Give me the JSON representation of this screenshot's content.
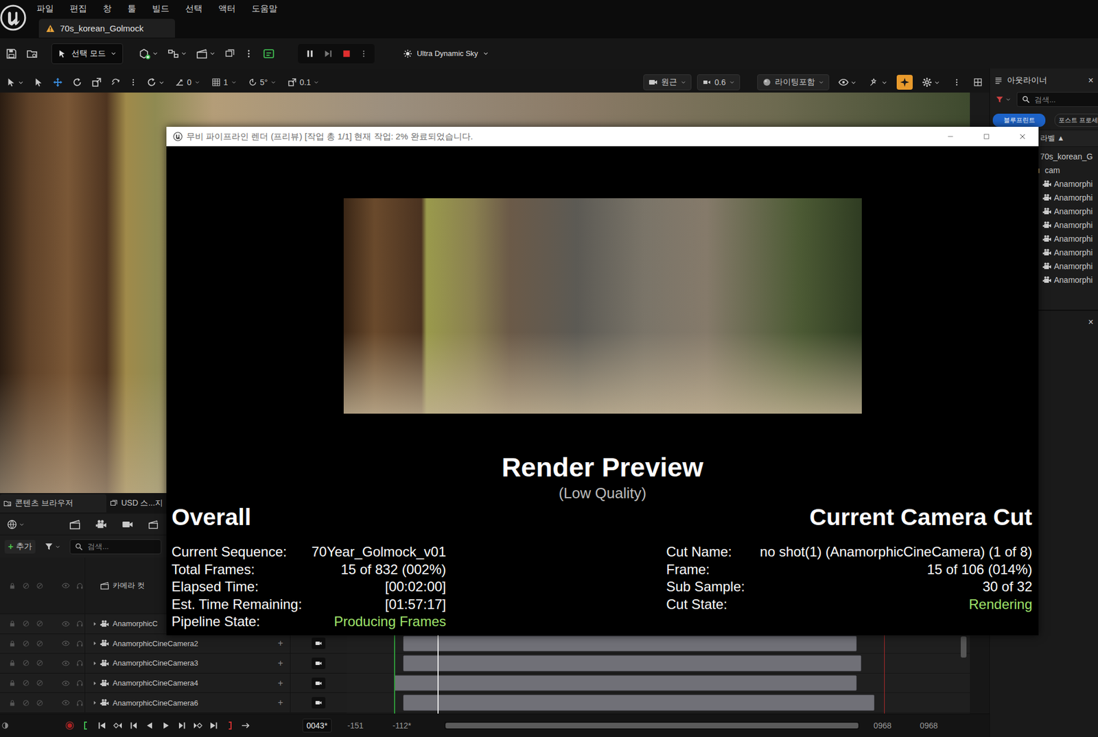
{
  "menu": [
    "파일",
    "편집",
    "창",
    "툴",
    "빌드",
    "선택",
    "액터",
    "도움말"
  ],
  "level_tab": {
    "label": "70s_korean_Golmock"
  },
  "toolbar": {
    "mode": "선택 모드",
    "playing": true,
    "sky": "Ultra Dynamic Sky"
  },
  "viewport_toolbar": {
    "transform_tools": [
      {
        "kind": "select",
        "selected": false
      },
      {
        "kind": "move",
        "selected": true
      },
      {
        "kind": "rotate",
        "selected": false
      },
      {
        "kind": "scale",
        "selected": false
      }
    ],
    "snaps": [
      {
        "kind": "surface",
        "value": "0"
      },
      {
        "kind": "grid",
        "value": "1"
      },
      {
        "kind": "rotate",
        "value": "5°"
      },
      {
        "kind": "scale",
        "value": "0.1"
      }
    ],
    "view": "원근",
    "camera_speed": "0.6",
    "view_mode": "라이팅포함",
    "highlight_toggle_on": true
  },
  "outliner": {
    "title": "아웃라이너",
    "close": "×",
    "search": "검색...",
    "tabs": [
      {
        "label": "블루프린트",
        "selected": true
      },
      {
        "label": "포스트 프로세",
        "selected": false
      }
    ],
    "sort_column": "라벨 ▲",
    "items": [
      {
        "label": "70s_korean_G",
        "kind": "level"
      },
      {
        "label": "cam",
        "kind": "folder"
      },
      {
        "label": "Anamorphi",
        "kind": "camera"
      },
      {
        "label": "Anamorphi",
        "kind": "camera"
      },
      {
        "label": "Anamorphi",
        "kind": "camera"
      },
      {
        "label": "Anamorphi",
        "kind": "camera"
      },
      {
        "label": "Anamorphi",
        "kind": "camera"
      },
      {
        "label": "Anamorphi",
        "kind": "camera"
      },
      {
        "label": "Anamorphi",
        "kind": "camera"
      },
      {
        "label": "Anamorphi",
        "kind": "camera"
      }
    ]
  },
  "details_panel": {
    "close": "×"
  },
  "bottom_tabs": [
    {
      "label": "콘텐츠 브라우저",
      "selected": true
    },
    {
      "label": "USD 스...지",
      "selected": false
    }
  ],
  "sequencer": {
    "add_icon": "+",
    "add": "추가",
    "search": "검색...",
    "camera_cut": "카메라 컷",
    "track_add": "+",
    "tracks": [
      {
        "label": "AnamorphicC"
      },
      {
        "label": "AnamorphicCineCamera2"
      },
      {
        "label": "AnamorphicCineCamera3"
      },
      {
        "label": "AnamorphicCineCamera4"
      },
      {
        "label": "AnamorphicCineCamera6"
      }
    ]
  },
  "timeline": {
    "current": "0043*",
    "view_start": "-151",
    "play_start": "-112*",
    "play_end": "0968",
    "view_end": "0968"
  },
  "render_window": {
    "title": "무비 파이프라인 렌더 (프리뷰) [작업 총 1/1] 현재 작업: 2% 완료되었습니다.",
    "heading": "Render Preview",
    "subheading": "(Low Quality)",
    "overall": {
      "title": "Overall",
      "rows": [
        {
          "label": "Current Sequence:",
          "value": "70Year_Golmock_v01",
          "kind": "value"
        },
        {
          "label": "Total Frames:",
          "value": "15 of 832 (002%)",
          "kind": "value"
        },
        {
          "label": "Elapsed Time:",
          "value": "[00:02:00]",
          "kind": "value"
        },
        {
          "label": "Est. Time Remaining:",
          "value": "[01:57:17]",
          "kind": "value"
        },
        {
          "label": "Pipeline State:",
          "value": "Producing Frames",
          "kind": "status"
        }
      ]
    },
    "camera_cut": {
      "title": "Current Camera Cut",
      "rows": [
        {
          "label": "Cut Name:",
          "value": "no shot(1) (AnamorphicCineCamera) (1 of 8)",
          "kind": "value"
        },
        {
          "label": "Frame:",
          "value": "15 of 106 (014%)",
          "kind": "value"
        },
        {
          "label": "Sub Sample:",
          "value": "30 of 32",
          "kind": "value"
        },
        {
          "label": "Cut State:",
          "value": "Rendering",
          "kind": "status"
        }
      ]
    }
  }
}
